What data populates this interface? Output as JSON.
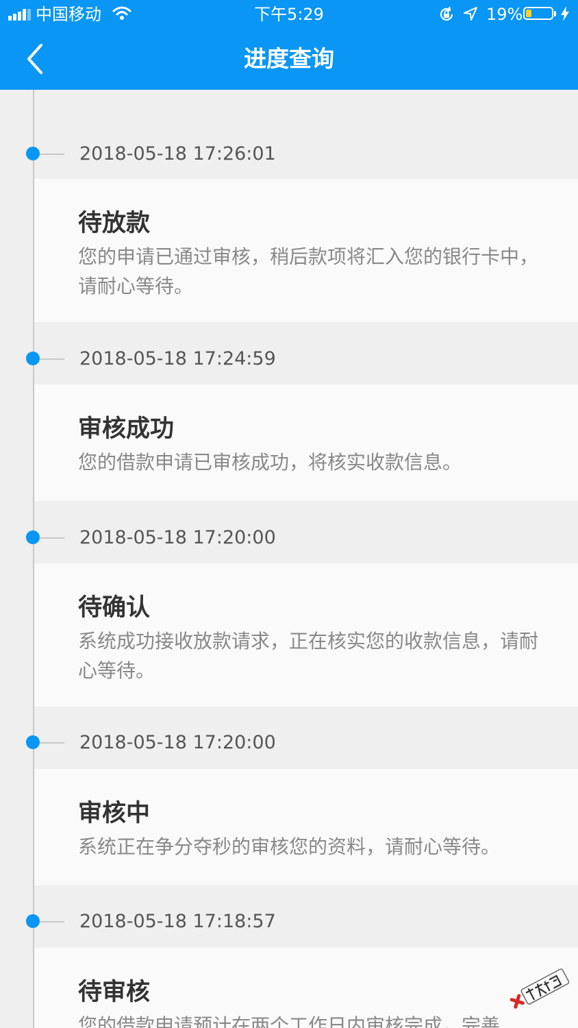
{
  "status_bar": {
    "carrier": "中国移动",
    "time": "下午5:29",
    "battery": "19%",
    "battery_level": 0.19
  },
  "nav": {
    "back_icon": "chevron-left-icon",
    "title": "进度查询"
  },
  "colors": {
    "brand": "#0a96f4",
    "timeline": "#c8c8c8",
    "background": "#efefef",
    "card": "#fafafa"
  },
  "timeline": [
    {
      "datetime": "2018-05-18 17:26:01",
      "title": "待放款",
      "description": "您的申请已通过审核，稍后款项将汇入您的银行卡中，请耐心等待。"
    },
    {
      "datetime": "2018-05-18 17:24:59",
      "title": "审核成功",
      "description": "您的借款申请已审核成功，将核实收款信息。"
    },
    {
      "datetime": "2018-05-18 17:20:00",
      "title": "待确认",
      "description": "系统成功接收放款请求，正在核实您的收款信息，请耐心等待。"
    },
    {
      "datetime": "2018-05-18 17:20:00",
      "title": "审核中",
      "description": "系统正在争分夺秒的审核您的资料，请耐心等待。"
    },
    {
      "datetime": "2018-05-18 17:18:57",
      "title": "待审核",
      "description": "您的借款申请预计在两个工作日内审核完成，完善"
    }
  ],
  "watermark": "卡农社区"
}
